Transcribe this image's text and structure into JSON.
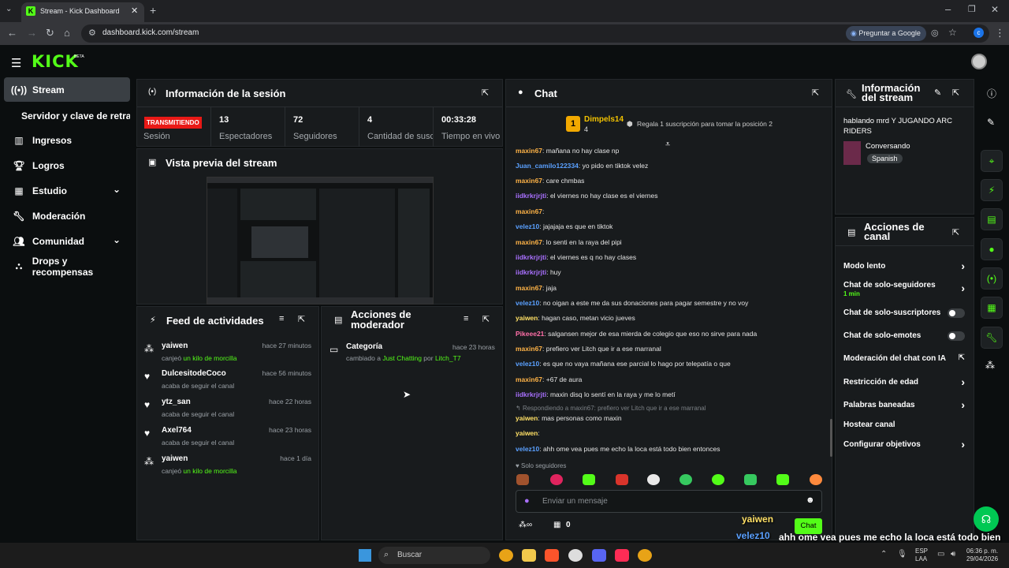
{
  "browser": {
    "tab_title": "Stream - Kick Dashboard",
    "url": "dashboard.kick.com/stream",
    "translate_label": "Preguntar a Google",
    "profile_initial": "c"
  },
  "app": {
    "logo": "KICK",
    "logo_badge": "BETA"
  },
  "sidebar": {
    "items": [
      {
        "label": "Stream",
        "icon": "broadcast-icon"
      },
      {
        "label": "Servidor y clave de retransn"
      },
      {
        "label": "Ingresos",
        "icon": "chart-icon"
      },
      {
        "label": "Logros",
        "icon": "trophy-icon"
      },
      {
        "label": "Estudio",
        "icon": "studio-icon"
      },
      {
        "label": "Moderación",
        "icon": "wrench-icon"
      },
      {
        "label": "Comunidad",
        "icon": "community-icon"
      },
      {
        "label": "Drops y recompensas",
        "icon": "drops-icon"
      }
    ]
  },
  "session": {
    "title": "Información de la sesión",
    "status_badge": "TRANSMITIENDO",
    "status_label": "Sesión",
    "stats": [
      {
        "value": "13",
        "label": "Espectadores"
      },
      {
        "value": "72",
        "label": "Seguidores"
      },
      {
        "value": "4",
        "label": "Cantidad de suscripciones"
      },
      {
        "value": "00:33:28",
        "label": "Tiempo en vivo"
      }
    ]
  },
  "preview": {
    "title": "Vista previa del stream"
  },
  "feed": {
    "title": "Feed de actividades",
    "items": [
      {
        "name": "yaiwen",
        "time": "hace 27 minutos",
        "desc": "canjeó ",
        "highlight": "un kilo de morcilla"
      },
      {
        "name": "DulcesitodeCoco",
        "time": "hace 56 minutos",
        "desc": "acaba de seguir el canal",
        "highlight": ""
      },
      {
        "name": "ytz_san",
        "time": "hace 22 horas",
        "desc": "acaba de seguir el canal",
        "highlight": ""
      },
      {
        "name": "Axel764",
        "time": "hace 23 horas",
        "desc": "acaba de seguir el canal",
        "highlight": ""
      },
      {
        "name": "yaiwen",
        "time": "hace 1 día",
        "desc": "canjeó ",
        "highlight": "un kilo de morcilla"
      }
    ]
  },
  "modactions": {
    "title_line1": "Acciones de",
    "title_line2": "moderador",
    "item": {
      "label": "Categoría",
      "time": "hace 23 horas",
      "pre": "cambiado a ",
      "category": "Just Chatting",
      "mid": " por ",
      "user": "Litch_T7"
    }
  },
  "chat": {
    "title": "Chat",
    "top_gifter": {
      "rank": "1",
      "name": "Dimpels14",
      "count": "4"
    },
    "gift_prompt": "Regala 1 suscripción para tomar la posición 2",
    "messages": [
      {
        "user": "maxin67",
        "text": "mañana no hay clase np",
        "color": "#ffb347"
      },
      {
        "user": "Juan_camilo122334",
        "text": "yo pido en tiktok velez",
        "color": "#5aa0ff"
      },
      {
        "user": "maxin67",
        "text": "care chmbas",
        "color": "#ffb347"
      },
      {
        "user": "iidkrkrjrjti",
        "text": "el viernes no hay clase es el viernes",
        "color": "#a970ff"
      },
      {
        "user": "maxin67",
        "text": "",
        "color": "#ffb347"
      },
      {
        "user": "velez10",
        "text": "jajajaja es que en tiktok",
        "color": "#5aa0ff"
      },
      {
        "user": "maxin67",
        "text": "lo senti en la raya del pipi",
        "color": "#ffb347"
      },
      {
        "user": "iidkrkrjrjti",
        "text": "el viernes es q no hay clases",
        "color": "#a970ff"
      },
      {
        "user": "iidkrkrjrjti",
        "text": "huy",
        "color": "#a970ff"
      },
      {
        "user": "maxin67",
        "text": "jaja",
        "color": "#ffb347"
      },
      {
        "user": "velez10",
        "text": "no oigan a este me da sus donaciones para pagar semestre y no voy",
        "color": "#5aa0ff"
      },
      {
        "user": "yaiwen",
        "text": "hagan caso, metan vicio jueves",
        "color": "#ffe066"
      },
      {
        "user": "Pikeee21",
        "text": "salgansen mejor de esa mierda de colegio que eso no sirve para nada",
        "color": "#ff6fa8"
      },
      {
        "user": "maxin67",
        "text": "prefiero ver Litch que ir a ese marranal",
        "color": "#ffb347"
      },
      {
        "user": "velez10",
        "text": "es que no vaya mañana ese parcial lo hago por telepatía o que",
        "color": "#5aa0ff"
      },
      {
        "user": "maxin67",
        "text": "+67 de aura",
        "color": "#ffb347"
      },
      {
        "user": "iidkrkrjrjti",
        "text": "maxin disq lo sentí en la raya y me lo metí",
        "color": "#a970ff"
      }
    ],
    "reply_context": "Respondiendo a maxin67: prefiero ver Litch que ir a ese marranal",
    "messages2": [
      {
        "user": "yaiwen",
        "text": "mas personas como maxin",
        "color": "#ffe066"
      },
      {
        "user": "yaiwen",
        "text": "",
        "color": "#ffe066"
      },
      {
        "user": "velez10",
        "text": "ahh ome vea pues me echo la loca está todo bien entonces",
        "color": "#5aa0ff"
      }
    ],
    "followers_only": "Solo seguidores",
    "input_placeholder": "Enviar un mensaje",
    "viewer_count": "0",
    "send_label": "Chat"
  },
  "stream_info": {
    "title_line1": "Información",
    "title_line2": "del stream",
    "stream_title": "hablando mrd Y JUGANDO ARC RIDERS",
    "category": "Conversando",
    "language": "Spanish"
  },
  "channel_actions": {
    "title_line1": "Acciones de",
    "title_line2": "canal",
    "rows": [
      {
        "label": "Modo lento",
        "sub": "",
        "control": "chevron"
      },
      {
        "label": "Chat de solo-seguidores",
        "sub": "1 min",
        "control": "chevron"
      },
      {
        "label": "Chat de solo-suscriptores",
        "sub": "",
        "control": "toggle"
      },
      {
        "label": "Chat de solo-emotes",
        "sub": "",
        "control": "toggle"
      },
      {
        "label": "Moderación del chat con IA",
        "sub": "",
        "control": "external"
      },
      {
        "label": "Restricción de edad",
        "sub": "",
        "control": "chevron"
      },
      {
        "label": "Palabras baneadas",
        "sub": "",
        "control": "chevron"
      },
      {
        "label": "Hostear canal",
        "sub": "",
        "control": "none"
      },
      {
        "label": "Configurar objetivos",
        "sub": "",
        "control": "chevron"
      }
    ]
  },
  "overlay": {
    "user1": "yaiwen",
    "user2": "velez10",
    "text": "ahh ome vea pues me echo la loca está todo bien entonces"
  },
  "taskbar": {
    "search_placeholder": "Buscar",
    "lang_line1": "ESP",
    "lang_line2": "LAA",
    "time": "06:36 p. m.",
    "date": "29/04/2026"
  },
  "colors": {
    "accent": "#53fc18",
    "live_red": "#e91916",
    "panel": "#181b1d"
  }
}
